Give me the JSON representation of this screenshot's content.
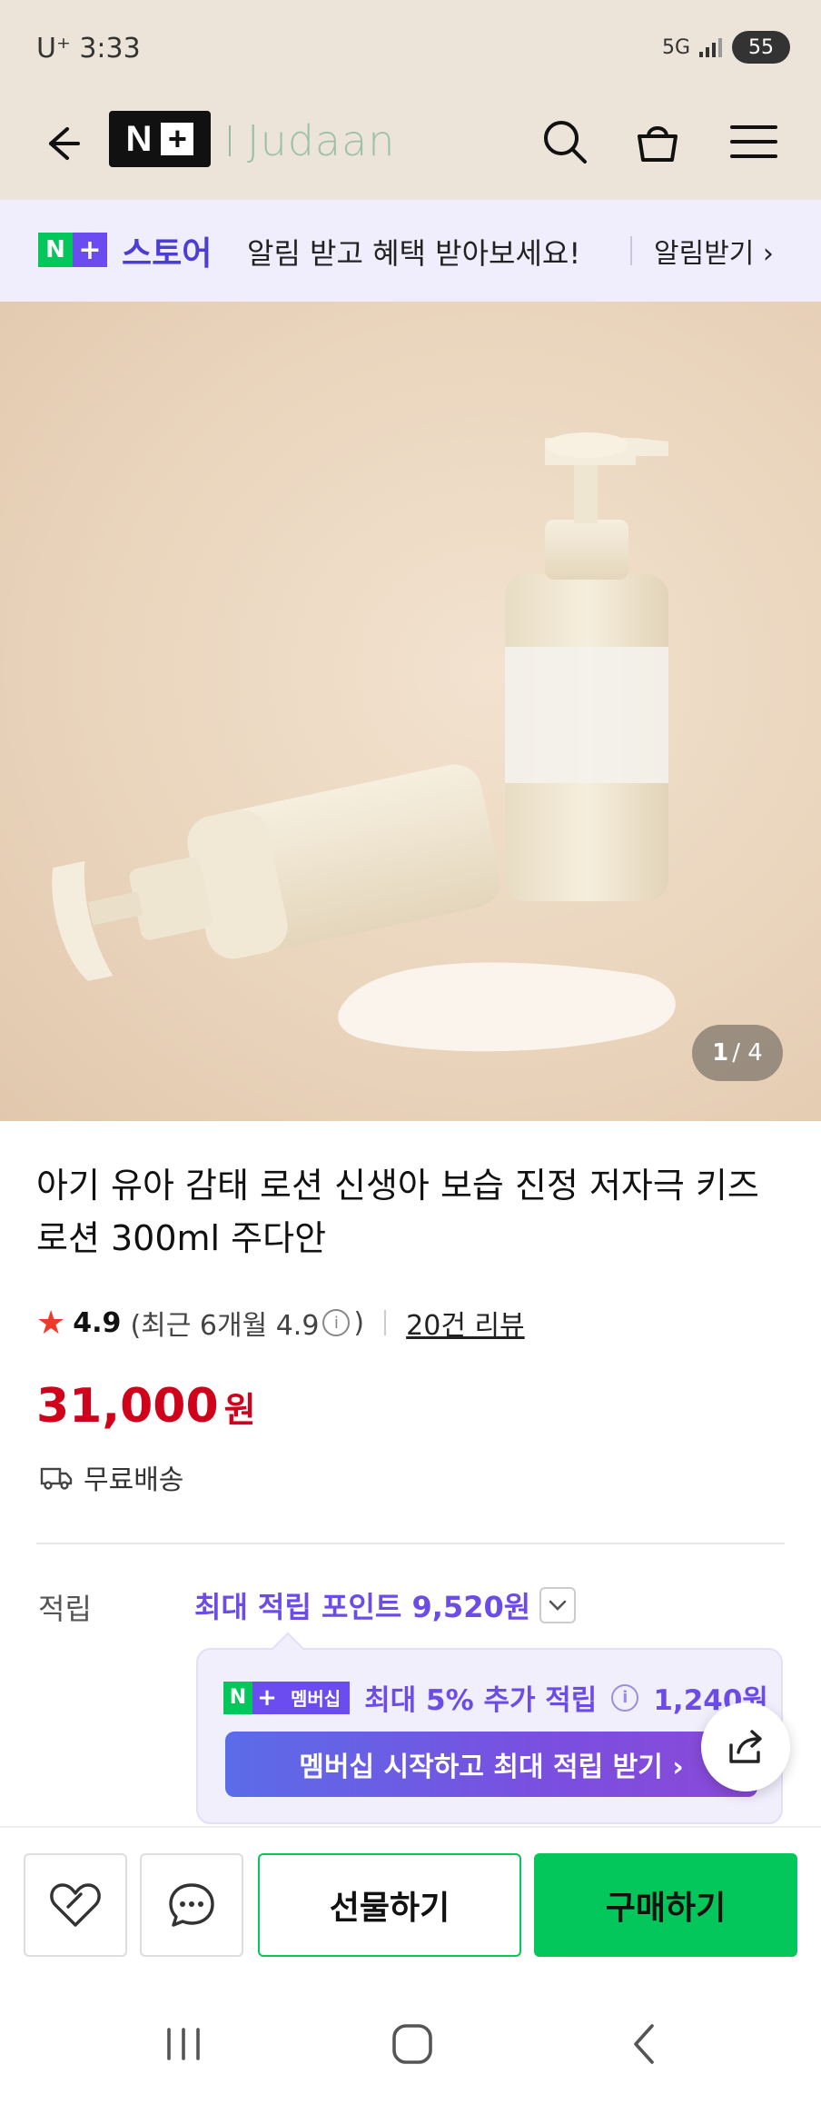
{
  "status_bar": {
    "carrier_time": "U⁺ 3:33",
    "network": "5G",
    "battery": "55"
  },
  "header": {
    "brand": "Judaan"
  },
  "notify_banner": {
    "store_label": "스토어",
    "message": "알림 받고 혜택 받아보세요!",
    "link": "알림받기 ›"
  },
  "gallery": {
    "current": "1",
    "total": "/ 4"
  },
  "product": {
    "title": "아기 유아 감태 로션 신생아 보습 진정 저자극 키즈로션 300ml 주다안",
    "rating": "4.9",
    "rating_detail_prefix": "(최근 6개월 4.9",
    "rating_detail_suffix": ")",
    "reviews": "20건 리뷰",
    "price": "31,000",
    "price_unit": "원",
    "shipping": "무료배송"
  },
  "points": {
    "label": "적립",
    "max_points": "최대 적립 포인트 9,520원",
    "membership_badge": "멤버십",
    "extra": "최대 5% 추가 적립",
    "extra_amount": "1,240원",
    "cta": "멤버십 시작하고 최대 적립 받기 ›"
  },
  "bottom_bar": {
    "gift": "선물하기",
    "buy": "구매하기"
  },
  "colors": {
    "brand_green": "#03c75a",
    "accent_purple": "#6b4ce6",
    "price_red": "#d0021b",
    "header_bg": "#ede4d9"
  }
}
